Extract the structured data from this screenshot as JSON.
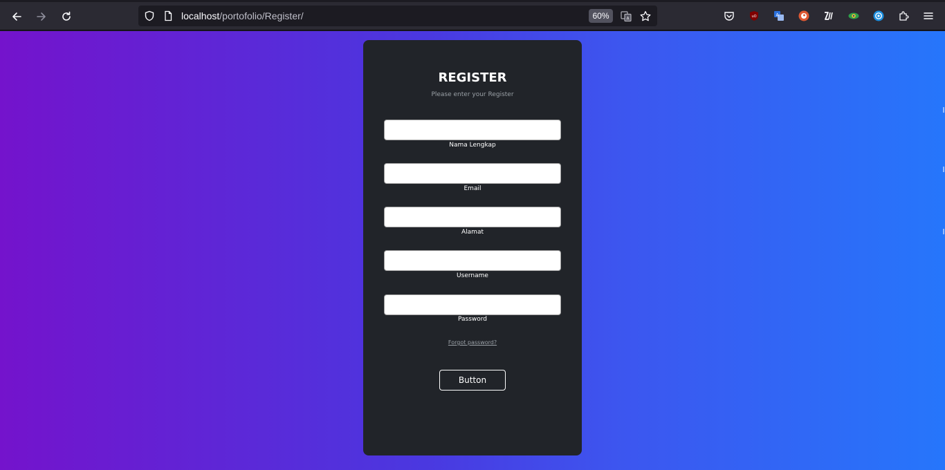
{
  "browser": {
    "url_host": "localhost",
    "url_path": "/portofolio/Register/",
    "zoom": "60%",
    "icons": [
      "back-icon",
      "forward-icon",
      "reload-icon",
      "shield-icon",
      "page-icon",
      "translate-icon",
      "bookmark-star-icon",
      "pocket-icon",
      "ublock-icon",
      "translator-icon",
      "duckduckgo-icon",
      "zotero-icon",
      "eye-extension-icon",
      "globe-extension-icon",
      "extensions-icon",
      "menu-icon"
    ]
  },
  "form": {
    "title": "REGISTER",
    "subtitle": "Please enter your Register",
    "fields": [
      {
        "label": "Nama Lengkap",
        "value": ""
      },
      {
        "label": "Email",
        "value": ""
      },
      {
        "label": "Alamat",
        "value": ""
      },
      {
        "label": "Username",
        "value": ""
      },
      {
        "label": "Password",
        "value": ""
      }
    ],
    "forgot_link": "Forgot password?",
    "button_label": "Button"
  },
  "colors": {
    "gradient_start": "#7413cc",
    "gradient_end": "#2676fb",
    "card_bg": "#212429"
  }
}
